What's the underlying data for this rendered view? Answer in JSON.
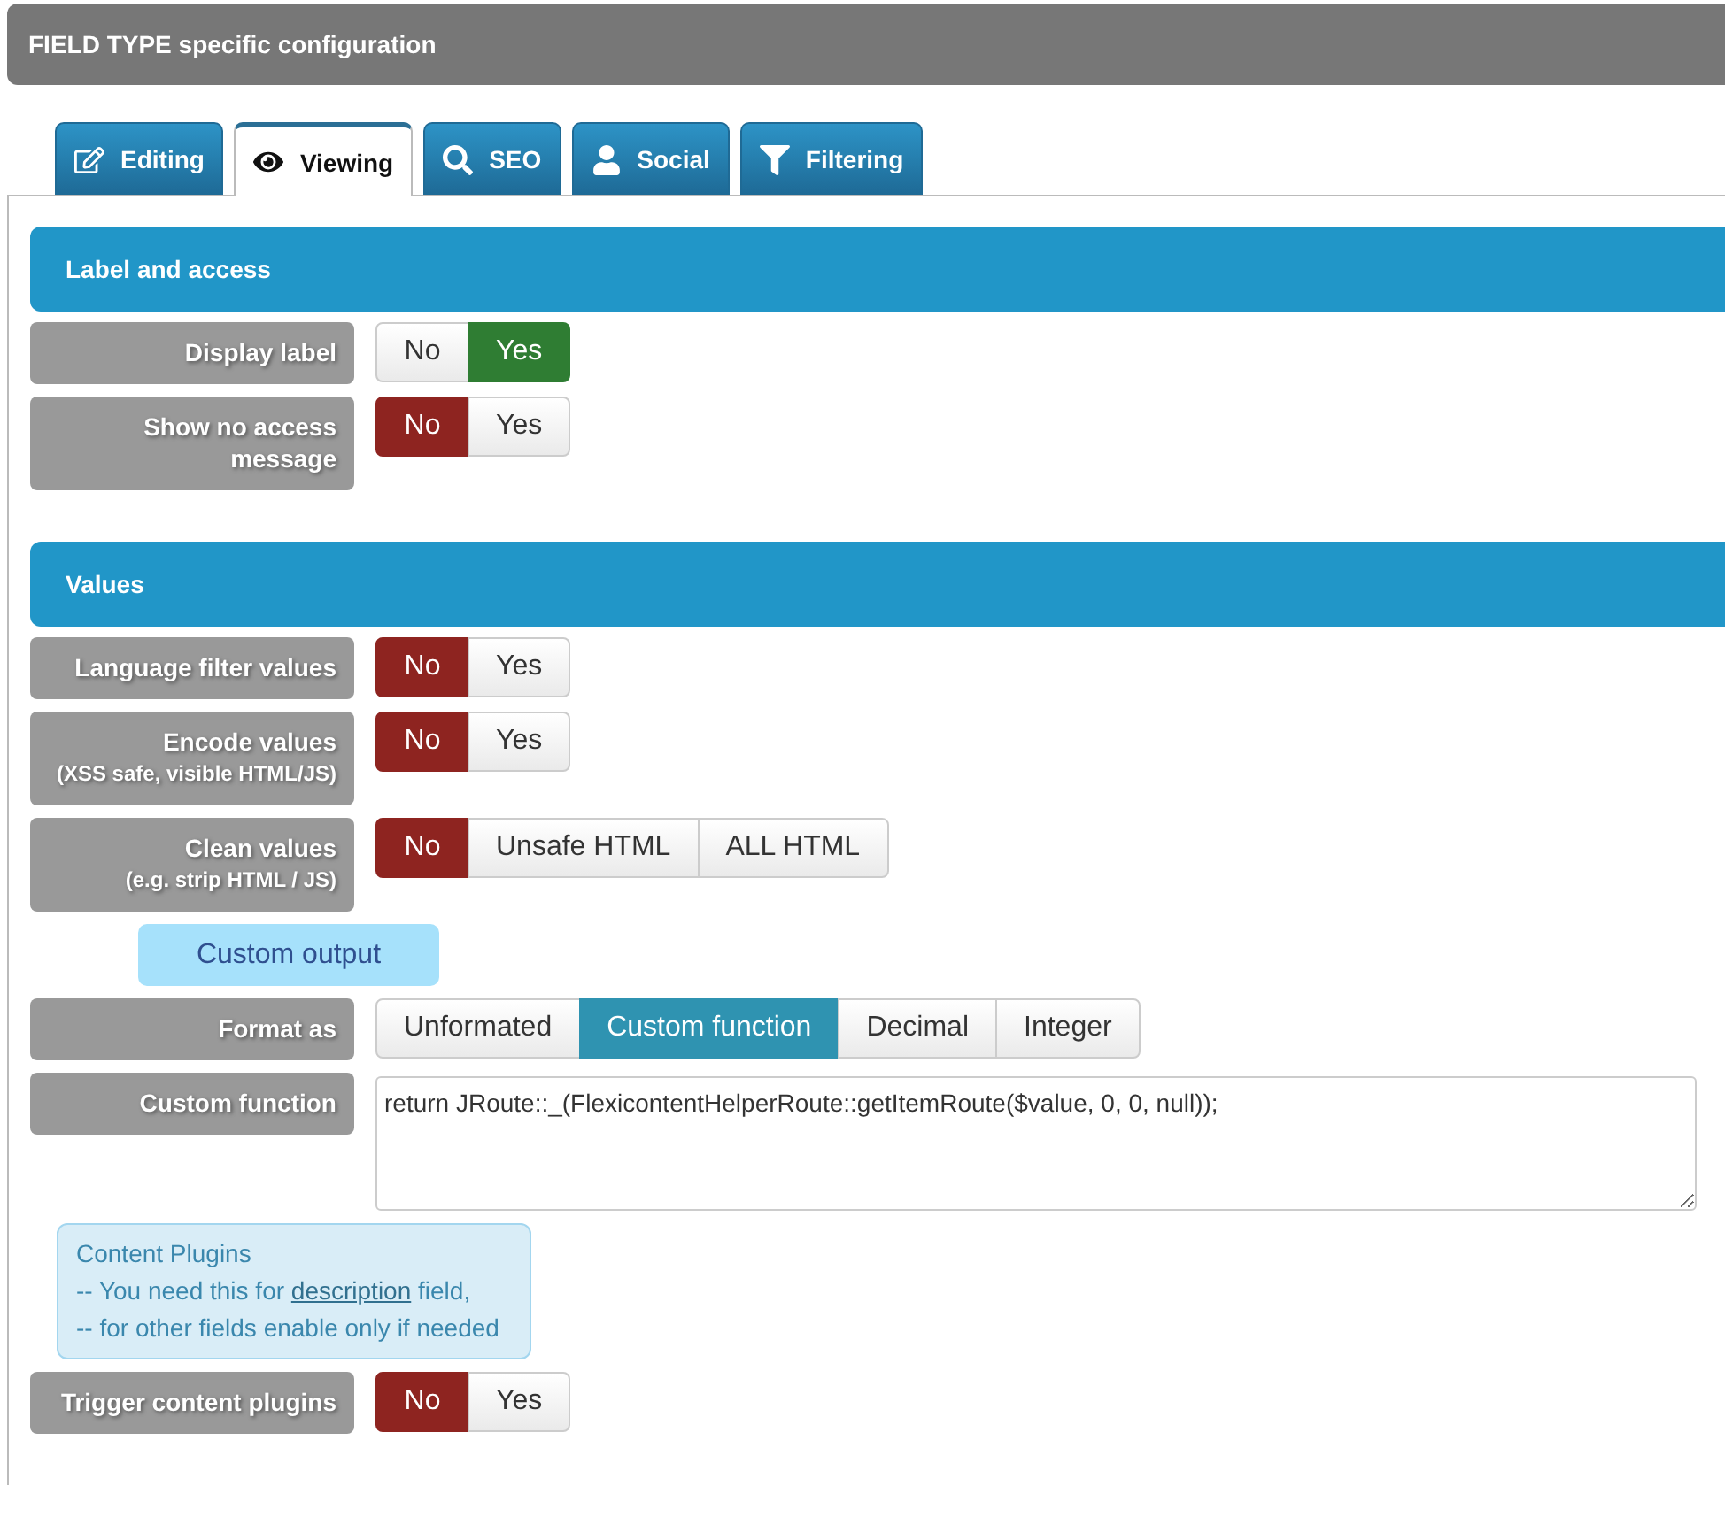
{
  "header": {
    "title": "FIELD TYPE specific configuration"
  },
  "tabs": [
    {
      "label": "Editing",
      "selected": false
    },
    {
      "label": "Viewing",
      "selected": true
    },
    {
      "label": "SEO",
      "selected": false
    },
    {
      "label": "Social",
      "selected": false
    },
    {
      "label": "Filtering",
      "selected": false
    }
  ],
  "sections": [
    {
      "title": "Label and access",
      "rows": [
        {
          "kind": "buttons",
          "label": "Display label",
          "options": [
            {
              "label": "No",
              "selected": false
            },
            {
              "label": "Yes",
              "selected": true,
              "color": "#2f7d33"
            }
          ]
        },
        {
          "kind": "buttons",
          "label": "Show no access message",
          "options": [
            {
              "label": "No",
              "selected": true,
              "color": "#8e2420"
            },
            {
              "label": "Yes",
              "selected": false
            }
          ]
        }
      ]
    },
    {
      "title": "Values",
      "rows": [
        {
          "kind": "buttons",
          "label": "Language filter values",
          "options": [
            {
              "label": "No",
              "selected": true,
              "color": "#8e2420"
            },
            {
              "label": "Yes",
              "selected": false
            }
          ]
        },
        {
          "kind": "buttons",
          "label": "Encode values",
          "sublabel": "(XSS safe, visible HTML/JS)",
          "options": [
            {
              "label": "No",
              "selected": true,
              "color": "#8e2420"
            },
            {
              "label": "Yes",
              "selected": false
            }
          ]
        },
        {
          "kind": "buttons",
          "label": "Clean values",
          "sublabel": "(e.g. strip HTML / JS)",
          "options": [
            {
              "label": "No",
              "selected": true,
              "color": "#8e2420"
            },
            {
              "label": "Unsafe HTML",
              "selected": false
            },
            {
              "label": "ALL HTML",
              "selected": false
            }
          ]
        },
        {
          "kind": "badge",
          "text": "Custom output"
        },
        {
          "kind": "buttons",
          "label": "Format as",
          "options": [
            {
              "label": "Unformated",
              "selected": false
            },
            {
              "label": "Custom function",
              "selected": true,
              "color": "#2f93b1"
            },
            {
              "label": "Decimal",
              "selected": false
            },
            {
              "label": "Integer",
              "selected": false
            }
          ]
        },
        {
          "kind": "textarea",
          "label": "Custom function",
          "value": "return JRoute::_(FlexicontentHelperRoute::getItemRoute($value, 0, 0, null));"
        },
        {
          "kind": "info",
          "title": "Content Plugins",
          "lines": [
            {
              "before": "-- You need this for ",
              "link": "description",
              "after": " field,"
            },
            {
              "before": "-- for other fields enable only if needed"
            }
          ]
        },
        {
          "kind": "buttons",
          "label": "Trigger content plugins",
          "options": [
            {
              "label": "No",
              "selected": true,
              "color": "#8e2420"
            },
            {
              "label": "Yes",
              "selected": false
            }
          ]
        }
      ]
    }
  ]
}
